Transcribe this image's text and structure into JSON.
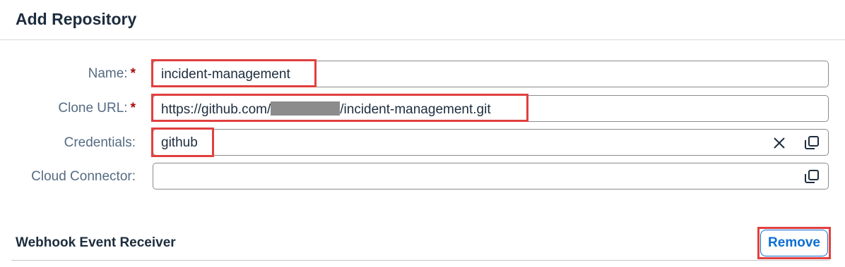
{
  "dialog": {
    "title": "Add Repository"
  },
  "form": {
    "name": {
      "label": "Name:",
      "required_mark": "*",
      "value": "incident-management"
    },
    "clone_url": {
      "label": "Clone URL:",
      "required_mark": "*",
      "value_prefix": "https://github.com/",
      "value_suffix": "/incident-management.git"
    },
    "credentials": {
      "label": "Credentials:",
      "value": "github",
      "clear_icon": "close-icon",
      "select_icon": "value-help-icon"
    },
    "cloud_connector": {
      "label": "Cloud Connector:",
      "value": "",
      "select_icon": "value-help-icon"
    }
  },
  "webhook": {
    "title": "Webhook Event Receiver",
    "remove_label": "Remove"
  },
  "colors": {
    "accent": "#0a6ed1",
    "required": "#aa0808",
    "highlight": "#e0403f"
  }
}
